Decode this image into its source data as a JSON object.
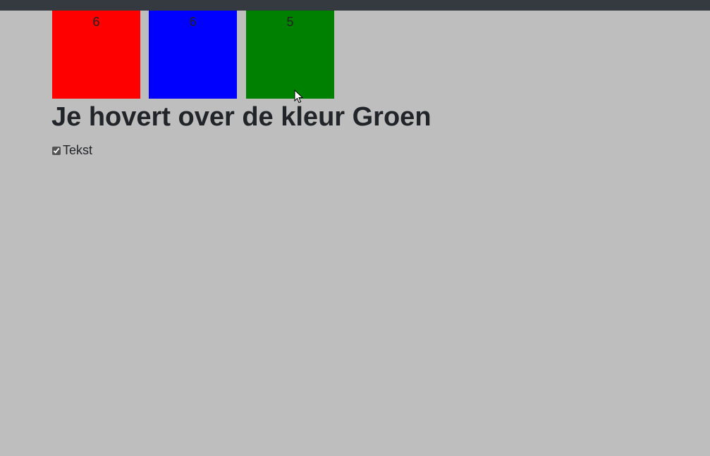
{
  "header": {
    "bar_color": "#343a40"
  },
  "boxes": [
    {
      "color_name": "red",
      "color": "#ff0000",
      "count": "6"
    },
    {
      "color_name": "blue",
      "color": "#0000ff",
      "count": "6"
    },
    {
      "color_name": "green",
      "color": "#008000",
      "count": "5"
    }
  ],
  "hover_message": "Je hovert over de kleur Groen",
  "checkbox": {
    "label": "Tekst",
    "checked": true
  },
  "cursor": {
    "icon": "mouse-pointer-icon"
  }
}
